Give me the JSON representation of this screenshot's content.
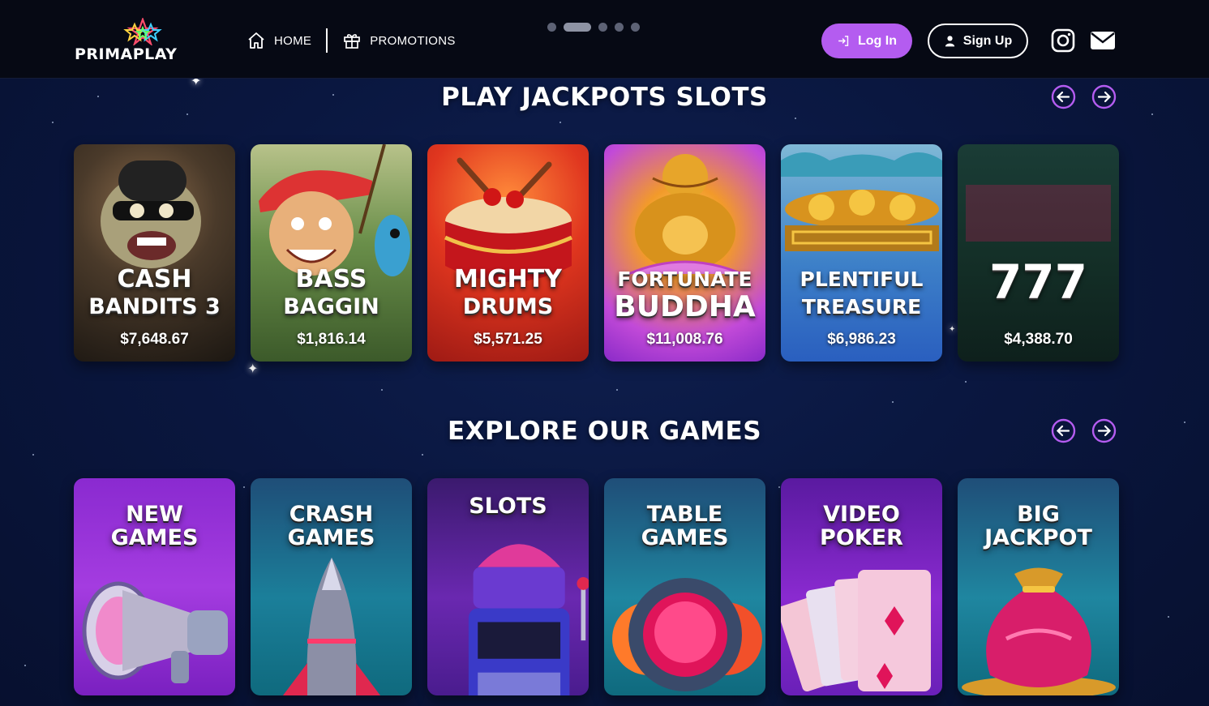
{
  "brand": {
    "name": "PRIMAPLAY"
  },
  "nav": {
    "home": "HOME",
    "promotions": "PROMOTIONS"
  },
  "carousel_dots": {
    "count": 5,
    "active_index": 1
  },
  "auth": {
    "login": "Log In",
    "signup": "Sign Up"
  },
  "social": [
    "instagram-icon",
    "mail-icon"
  ],
  "jackpots": {
    "title": "PLAY JACKPOTS SLOTS",
    "games": [
      {
        "line1": "CASH",
        "line2": "BANDITS 3",
        "amount": "$7,648.67"
      },
      {
        "line1": "BASS",
        "line2": "BAGGIN",
        "amount": "$1,816.14"
      },
      {
        "line1": "MIGHTY",
        "line2": "DRUMS",
        "amount": "$5,571.25"
      },
      {
        "line1": "FORTUNATE",
        "line2": "BUDDHA",
        "amount": "$11,008.76"
      },
      {
        "line1": "PLENTIFUL",
        "line2": "TREASURE",
        "amount": "$6,986.23"
      },
      {
        "line1": "777",
        "line2": "",
        "amount": "$4,388.70"
      }
    ]
  },
  "explore": {
    "title": "EXPLORE OUR GAMES",
    "categories": [
      "NEW\nGAMES",
      "CRASH\nGAMES",
      "SLOTS",
      "TABLE\nGAMES",
      "VIDEO\nPOKER",
      "BIG\nJACKPOT"
    ]
  },
  "colors": {
    "accent": "#b45cf0",
    "header_bg": "#060914",
    "page_bg": "#0a1740"
  }
}
